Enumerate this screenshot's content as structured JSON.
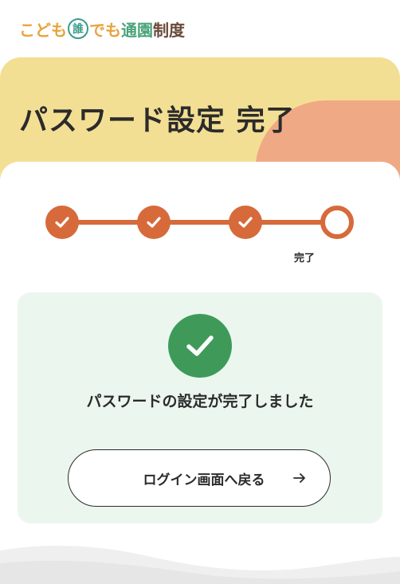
{
  "header": {
    "logo_parts": [
      "こども",
      "誰",
      "でも",
      "通園",
      "制度"
    ]
  },
  "hero": {
    "title": "パスワード設定 完了"
  },
  "stepper": {
    "steps_total": 4,
    "steps_completed": 3,
    "current_label": "完了"
  },
  "result": {
    "message": "パスワードの設定が完了しました",
    "button_label": "ログイン画面へ戻る",
    "button_icon": "arrow-right-icon"
  },
  "colors": {
    "accent": "#d76a3b",
    "success": "#3f9a5a",
    "hero_bg": "#f3df94",
    "hero_blob": "#f0a985",
    "panel_bg": "#ebf7ee"
  }
}
